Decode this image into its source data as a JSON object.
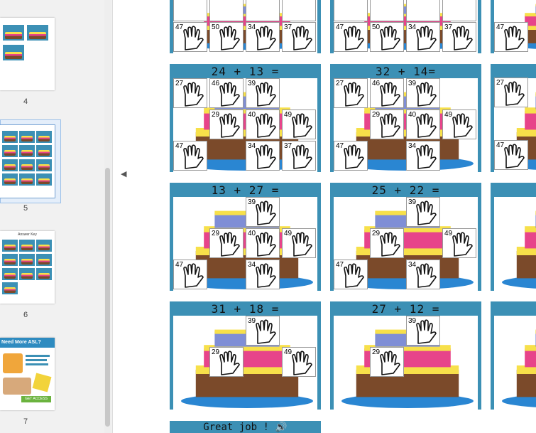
{
  "sidebar": {
    "pages": [
      {
        "num": "4",
        "selected": false
      },
      {
        "num": "5",
        "selected": true
      },
      {
        "num": "6",
        "selected": false,
        "heading": "Answer Key"
      },
      {
        "num": "7",
        "selected": false,
        "promo": {
          "heading": "Need More ASL?",
          "button": "GET ACCESS"
        }
      }
    ]
  },
  "cards": [
    {
      "title": "24 + 13 =",
      "cells": [
        "27",
        "46",
        "39",
        "29",
        "40",
        "49",
        "47",
        "34",
        "37"
      ]
    },
    {
      "title": "32 + 14=",
      "cells": [
        "27",
        "46",
        "39",
        "29",
        "40",
        "49",
        "47",
        "34"
      ]
    },
    {
      "title": "13 + 27 =",
      "cells": [
        "39",
        "29",
        "40",
        "49",
        "47",
        "34"
      ]
    },
    {
      "title": "25 + 22 =",
      "cells": [
        "39",
        "29",
        "49",
        "47",
        "34"
      ]
    },
    {
      "title": "31 + 18  =",
      "cells": [
        "39",
        "29",
        "49"
      ]
    },
    {
      "title": "27 + 12  =",
      "cells": [
        "39",
        "29"
      ]
    }
  ],
  "top_row": {
    "cells": [
      "47",
      "50",
      "34",
      "37"
    ]
  },
  "footer": {
    "text": "Great job ! 🔊"
  },
  "colors": {
    "card_border": "#3c90b5",
    "cake_yellow": "#f7e04a",
    "cake_pink": "#e7448a",
    "cake_brown": "#7b4a2a",
    "plate_blue": "#2a86d2"
  }
}
